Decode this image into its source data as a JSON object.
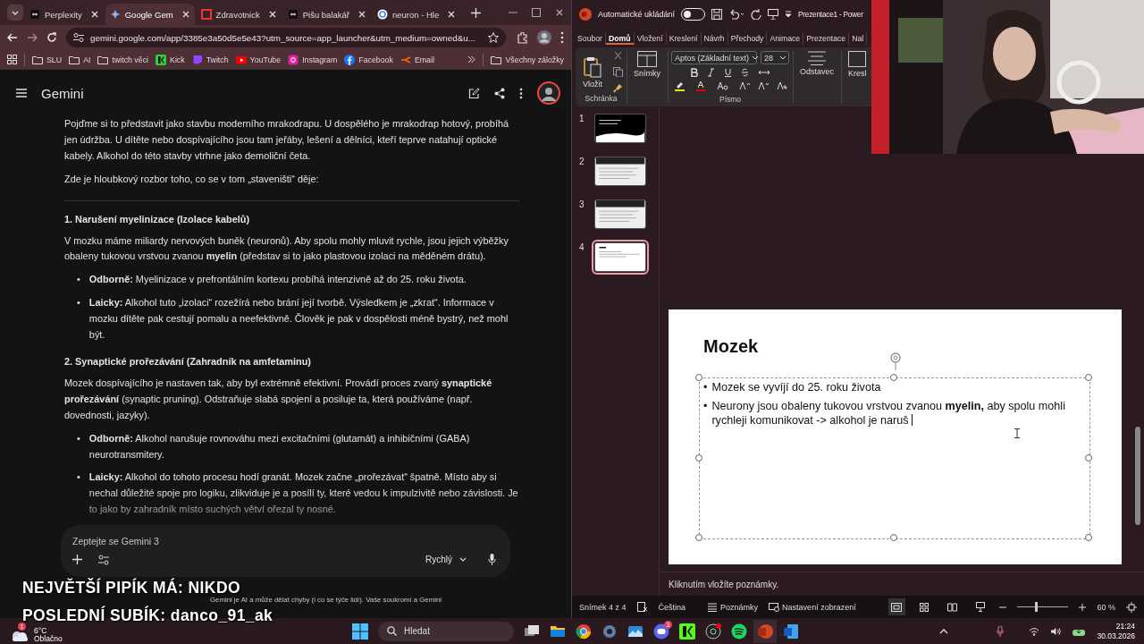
{
  "browser": {
    "tabs": [
      {
        "label": "Perplexity",
        "selected": false
      },
      {
        "label": "Google Gem",
        "selected": true
      },
      {
        "label": "Zdravotnick",
        "selected": false
      },
      {
        "label": "Pišu balakář",
        "selected": false
      },
      {
        "label": "neuron - Hle",
        "selected": false
      }
    ],
    "url": "gemini.google.com/app/3385e3a50d5e5e43?utm_source=app_launcher&utm_medium=owned&u...",
    "bookmarks": [
      {
        "label": "SLU",
        "kind": "folder"
      },
      {
        "label": "AI",
        "kind": "folder"
      },
      {
        "label": "twitch věci",
        "kind": "folder"
      },
      {
        "label": "Kick",
        "kind": "kick"
      },
      {
        "label": "Twitch",
        "kind": "twitch"
      },
      {
        "label": "YouTube",
        "kind": "youtube"
      },
      {
        "label": "Instagram",
        "kind": "instagram"
      },
      {
        "label": "Facebook",
        "kind": "facebook"
      },
      {
        "label": "Email",
        "kind": "email"
      }
    ],
    "all_bookmarks": "Všechny záložky"
  },
  "gemini": {
    "title": "Gemini",
    "bullet_mark": "•",
    "blocks": [
      {
        "kind": "paragraph",
        "text": "Pojďme si to představit jako stavbu moderního mrakodrapu. U dospělého je mrakodrap hotový, probíhá jen údržba. U dítěte nebo dospívajícího jsou tam jeřáby, lešení a dělníci, kteří teprve natahují optické kabely. Alkohol do této stavby vtrhne jako demoliční četa."
      },
      {
        "kind": "paragraph",
        "text": "Zde je hloubkový rozbor toho, co se v tom „staveništi“ děje:"
      },
      {
        "kind": "divider"
      },
      {
        "kind": "heading",
        "text": "1. Narušení myelinizace (Izolace kabelů)"
      },
      {
        "kind": "paragraph",
        "text": "V mozku máme miliardy nervových buněk (neuronů). Aby spolu mohly mluvit rychle, jsou jejich výběžky obaleny tukovou vrstvou zvanou **myelin** (představ si to jako plastovou izolaci na měděném drátu)."
      },
      {
        "kind": "bullet",
        "text": "**Odborně:** Myelinizace v prefrontálním kortexu probíhá intenzivně až do 25. roku života."
      },
      {
        "kind": "bullet",
        "text": "**Laicky:** Alkohol tuto „izolaci“ rozežírá nebo brání její tvorbě. Výsledkem je „zkrat“. Informace v mozku dítěte pak cestují pomalu a neefektivně. Člověk je pak v dospělosti méně bystrý, než mohl být."
      },
      {
        "kind": "heading",
        "text": "2. Synaptické prořezávání (Zahradník na amfetaminu)"
      },
      {
        "kind": "paragraph",
        "text": "Mozek dospívajícího je nastaven tak, aby byl extrémně efektivní. Provádí proces zvaný **synaptické prořezávání** (synaptic pruning). Odstraňuje slabá spojení a posiluje ta, která používáme (např. dovednosti, jazyky)."
      },
      {
        "kind": "bullet",
        "text": "**Odborně:** Alkohol narušuje rovnováhu mezi excitačními (glutamát) a inhibičními (GABA) neurotransmitery."
      },
      {
        "kind": "bullet",
        "text": "**Laicky:** Alkohol do tohoto procesu hodí granát. Mozek začne „prořezávat“ špatně. Místo aby si nechal důležité spoje pro logiku, zlikviduje je a posílí ty, které vedou k impulzivitě nebo závislosti. Je to jako by zahradník místo suchých větví ořezal ty nosné."
      }
    ],
    "prompt_placeholder": "Zeptejte se Gemini 3",
    "mode": "Rychlý",
    "disclaimer": "Gemini je AI a může dělat chyby (i co se týče lidí).",
    "privacy_link": "Vaše soukromí a Gemini"
  },
  "powerpoint": {
    "autosave_label": "Automatické ukládání",
    "autosave_on": false,
    "doc_title": "Prezentace1 - Power",
    "menus": [
      {
        "label": "Soubor",
        "selected": false
      },
      {
        "label": "Domů",
        "selected": true
      },
      {
        "label": "Vložení",
        "selected": false
      },
      {
        "label": "Kreslení",
        "selected": false
      },
      {
        "label": "Návrh",
        "selected": false
      },
      {
        "label": "Přechody",
        "selected": false
      },
      {
        "label": "Animace",
        "selected": false
      },
      {
        "label": "Prezentace",
        "selected": false
      },
      {
        "label": "Nal",
        "selected": false
      }
    ],
    "ribbon": {
      "paste": "Vložit",
      "clipboard": "Schránka",
      "slides": "Snímky",
      "font_name": "Aptos (Základní text)",
      "font_size": "28",
      "font_group": "Písmo",
      "paragraph": "Odstavec",
      "draw": "Kresl"
    },
    "thumbnails": [
      {
        "number": "1",
        "kind": "dark",
        "selected": false
      },
      {
        "number": "2",
        "kind": "light",
        "selected": false
      },
      {
        "number": "3",
        "kind": "light",
        "selected": false
      },
      {
        "number": "4",
        "kind": "blank",
        "selected": true
      }
    ],
    "slide": {
      "title": "Mozek",
      "bullet_mark": "•",
      "bullets": [
        "Mozek se vyvíjí do 25. roku života",
        "Neurony jsou obaleny tukovou vrstvou zvanou **myelin,** aby spolu mohli rychleji komunikovat -> alkohol je naruš"
      ]
    },
    "notes_placeholder": "Kliknutím vložíte poznámky.",
    "status": {
      "slide_count": "Snímek 4 z 4",
      "language": "Čeština",
      "notes": "Poznámky",
      "view_settings": "Nastavení zobrazení",
      "zoom": "60 %",
      "level": 0.35
    }
  },
  "taskbar": {
    "weather_badge": "1",
    "temperature": "6°C",
    "weather": "Oblačno",
    "search": "Hledat",
    "chat_badge": "3",
    "time": "21:24",
    "date": "30.03.2026"
  },
  "overlay": {
    "lines": [
      "NEJVĚTŠÍ PIPÍK MÁ: NIKDO",
      "POSLEDNÍ SUBÍK: danco_91_ak"
    ]
  }
}
